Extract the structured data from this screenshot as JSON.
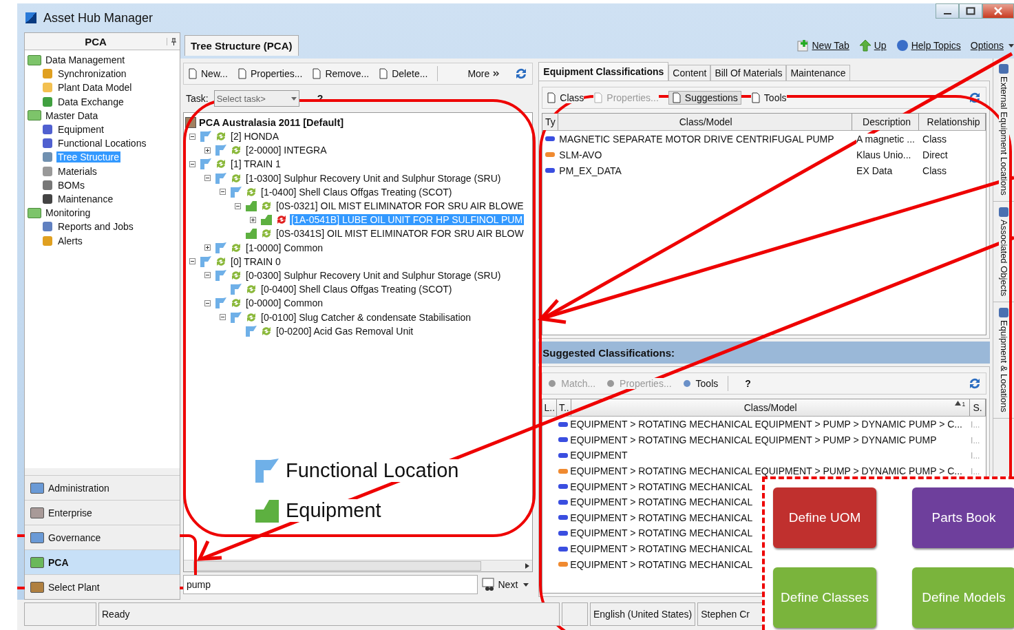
{
  "window": {
    "title": "Asset Hub Manager"
  },
  "nav": {
    "title": "PCA",
    "tree": [
      {
        "label": "Data Management",
        "selected": false,
        "children": [
          {
            "label": "Synchronization",
            "selected": false
          },
          {
            "label": "Plant Data Model",
            "selected": false
          },
          {
            "label": "Data Exchange",
            "selected": false
          }
        ]
      },
      {
        "label": "Master Data",
        "selected": false,
        "children": [
          {
            "label": "Equipment",
            "selected": false
          },
          {
            "label": "Functional Locations",
            "selected": false
          },
          {
            "label": "Tree Structure",
            "selected": true
          },
          {
            "label": "Materials",
            "selected": false
          },
          {
            "label": "BOMs",
            "selected": false
          },
          {
            "label": "Maintenance",
            "selected": false
          }
        ]
      },
      {
        "label": "Monitoring",
        "selected": false,
        "children": [
          {
            "label": "Reports and Jobs",
            "selected": false
          },
          {
            "label": "Alerts",
            "selected": false
          }
        ]
      }
    ],
    "groups": [
      {
        "label": "Administration",
        "selected": false,
        "color": "#6a9ad6"
      },
      {
        "label": "Enterprise",
        "selected": false,
        "color": "#a89a98"
      },
      {
        "label": "Governance",
        "selected": false,
        "color": "#6a9ad6"
      },
      {
        "label": "PCA",
        "selected": true,
        "color": "#6ab85a"
      },
      {
        "label": "Select Plant",
        "selected": false,
        "color": "#b08040"
      }
    ]
  },
  "center": {
    "tab": {
      "label": "Tree Structure (PCA)",
      "selected": true
    },
    "toolbar": [
      {
        "label": "New..."
      },
      {
        "label": "Properties..."
      },
      {
        "label": "Remove..."
      },
      {
        "label": "Delete..."
      }
    ],
    "more": "More",
    "task": {
      "label": "Task:",
      "placeholder": "Select task>",
      "help": "?"
    },
    "tree": {
      "root": "PCA Australasia 2011 [Default]",
      "children": [
        {
          "label": "[2] HONDA",
          "kind": "location",
          "selected": false,
          "expanded": true,
          "children": [
            {
              "label": "[2-0000] INTEGRA",
              "kind": "location",
              "selected": false,
              "expanded": false
            }
          ]
        },
        {
          "label": "[1] TRAIN 1",
          "kind": "location",
          "selected": false,
          "expanded": true,
          "children": [
            {
              "label": "[1-0300] Sulphur Recovery Unit and Sulphur Storage (SRU)",
              "kind": "location",
              "selected": false,
              "expanded": true,
              "children": [
                {
                  "label": "[1-0400] Shell Claus Offgas Treating (SCOT)",
                  "kind": "location",
                  "selected": false,
                  "expanded": true,
                  "children": [
                    {
                      "label": "[0S-0321] OIL MIST ELIMINATOR FOR SRU AIR BLOWE",
                      "kind": "equipment",
                      "selected": false,
                      "expanded": true,
                      "children": [
                        {
                          "label": "[1A-0541B] LUBE OIL UNIT FOR HP SULFINOL PUM",
                          "kind": "equipment",
                          "selected": true,
                          "expanded": false
                        }
                      ]
                    },
                    {
                      "label": "[0S-0341S] OIL MIST ELIMINATOR FOR SRU AIR BLOW",
                      "kind": "equipment",
                      "selected": false
                    }
                  ]
                }
              ]
            },
            {
              "label": "[1-0000] Common",
              "kind": "location",
              "selected": false,
              "expanded": false
            }
          ]
        },
        {
          "label": "[0] TRAIN 0",
          "kind": "location",
          "selected": false,
          "expanded": true,
          "children": [
            {
              "label": "[0-0300] Sulphur Recovery Unit and Sulphur Storage (SRU)",
              "kind": "location",
              "selected": false,
              "expanded": true,
              "children": [
                {
                  "label": "[0-0400] Shell Claus Offgas Treating (SCOT)",
                  "kind": "location",
                  "selected": false
                }
              ]
            },
            {
              "label": "[0-0000] Common",
              "kind": "location",
              "selected": false,
              "expanded": true,
              "children": [
                {
                  "label": "[0-0100] Slug Catcher & condensate Stabilisation",
                  "kind": "location",
                  "selected": false,
                  "expanded": true,
                  "children": [
                    {
                      "label": "[0-0200] Acid Gas Removal Unit",
                      "kind": "location",
                      "selected": false
                    }
                  ]
                }
              ]
            }
          ]
        }
      ]
    },
    "legend": [
      {
        "label": "Functional Location",
        "kind": "location"
      },
      {
        "label": "Equipment",
        "kind": "equipment"
      }
    ],
    "search": {
      "value": "pump"
    },
    "next": "Next"
  },
  "actions": [
    {
      "label": "New Tab"
    },
    {
      "label": "Up"
    },
    {
      "label": "Help Topics"
    },
    {
      "label": "Options"
    }
  ],
  "details": {
    "tabs": [
      {
        "label": "Equipment Classifications",
        "selected": true
      },
      {
        "label": "Content",
        "selected": false
      },
      {
        "label": "Bill Of Materials",
        "selected": false
      },
      {
        "label": "Maintenance",
        "selected": false
      }
    ],
    "toolbar": [
      {
        "label": "Class",
        "disabled": false,
        "pressed": false
      },
      {
        "label": "Properties...",
        "disabled": true,
        "pressed": false
      },
      {
        "label": "Suggestions",
        "disabled": false,
        "pressed": true
      },
      {
        "label": "Tools",
        "disabled": false,
        "pressed": false
      }
    ],
    "columns": [
      "Ty",
      "Class/Model",
      "Description",
      "Relationship"
    ],
    "rows": [
      {
        "color": "#3a4ee0",
        "class_model": "MAGNETIC SEPARATE MOTOR DRIVE CENTRIFUGAL PUMP",
        "description": "A magnetic ...",
        "relationship": "Class"
      },
      {
        "color": "#f08a30",
        "class_model": "SLM-AVO",
        "description": "Klaus Unio...",
        "relationship": "Direct"
      },
      {
        "color": "#3a4ee0",
        "class_model": "PM_EX_DATA",
        "description": "EX Data",
        "relationship": "Class"
      }
    ]
  },
  "suggested": {
    "title": "Suggested Classifications:",
    "toolbar": [
      {
        "label": "Match...",
        "disabled": true
      },
      {
        "label": "Properties...",
        "disabled": true
      },
      {
        "label": "Tools",
        "disabled": false
      }
    ],
    "help": "?",
    "columns": [
      "L..",
      "T..",
      "Class/Model",
      "S."
    ],
    "sort_order": "1",
    "rows": [
      {
        "color": "#3a4ee0",
        "class_model": "EQUIPMENT > ROTATING MECHANICAL EQUIPMENT > PUMP > DYNAMIC PUMP > C...",
        "s": "I..."
      },
      {
        "color": "#3a4ee0",
        "class_model": "EQUIPMENT > ROTATING MECHANICAL EQUIPMENT > PUMP > DYNAMIC PUMP",
        "s": "I..."
      },
      {
        "color": "#3a4ee0",
        "class_model": "EQUIPMENT",
        "s": "I..."
      },
      {
        "color": "#f08a30",
        "class_model": "EQUIPMENT > ROTATING MECHANICAL EQUIPMENT > PUMP > DYNAMIC PUMP > C...",
        "s": "I..."
      },
      {
        "color": "#3a4ee0",
        "class_model": "EQUIPMENT > ROTATING MECHANICAL"
      },
      {
        "color": "#3a4ee0",
        "class_model": "EQUIPMENT > ROTATING MECHANICAL"
      },
      {
        "color": "#3a4ee0",
        "class_model": "EQUIPMENT > ROTATING MECHANICAL"
      },
      {
        "color": "#3a4ee0",
        "class_model": "EQUIPMENT > ROTATING MECHANICAL"
      },
      {
        "color": "#3a4ee0",
        "class_model": "EQUIPMENT > ROTATING MECHANICAL"
      },
      {
        "color": "#f08a30",
        "class_model": "EQUIPMENT > ROTATING MECHANICAL"
      }
    ]
  },
  "side_tabs": [
    {
      "label": "External Equipment Locations"
    },
    {
      "label": "Associated Objects"
    },
    {
      "label": "Equipment & Locations"
    }
  ],
  "flowchart": [
    {
      "label": "Define UOM",
      "color": "#c0302e"
    },
    {
      "label": "Parts Book",
      "color": "#6e3f9c"
    },
    {
      "label": "Define Classes",
      "color": "#7ab43c"
    },
    {
      "label": "Define Models",
      "color": "#7ab43c"
    }
  ],
  "status_bar": {
    "left": "Ready",
    "language": "English (United States)",
    "user": "Stephen Cr"
  }
}
